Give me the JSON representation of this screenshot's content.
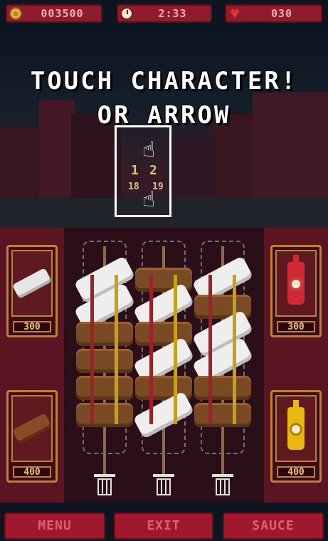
{
  "hud": {
    "coins": "003500",
    "timer": "2:33",
    "lives": "030",
    "coin_icon": "coin-icon",
    "timer_icon": "clock-icon",
    "lives_icon": "heart-icon"
  },
  "tutorial": {
    "line1": "TOUCH CHARACTER!",
    "line2": "OR ARROW",
    "hint_numbers": [
      "1",
      "2",
      "18",
      "19"
    ]
  },
  "shop": {
    "left": [
      {
        "item": "bun",
        "price": "300"
      },
      {
        "item": "sausage",
        "price": "400"
      }
    ],
    "right": [
      {
        "item": "ketchup",
        "price": "300"
      },
      {
        "item": "mustard",
        "price": "400"
      }
    ]
  },
  "skewers": [
    [
      "bun",
      "bun",
      "sausage",
      "sausage",
      "sausage",
      "sausage"
    ],
    [
      "sausage",
      "bun",
      "sausage",
      "bun",
      "sausage",
      "bun"
    ],
    [
      "bun",
      "sausage",
      "bun",
      "bun",
      "sausage",
      "sausage"
    ]
  ],
  "buttons": {
    "menu": "MENU",
    "exit": "EXIT",
    "sauce": "SAUCE"
  },
  "colors": {
    "accent": "#a0182c",
    "gold": "#c08030",
    "ketchup": "#d02a35",
    "mustard": "#e7b80f"
  }
}
